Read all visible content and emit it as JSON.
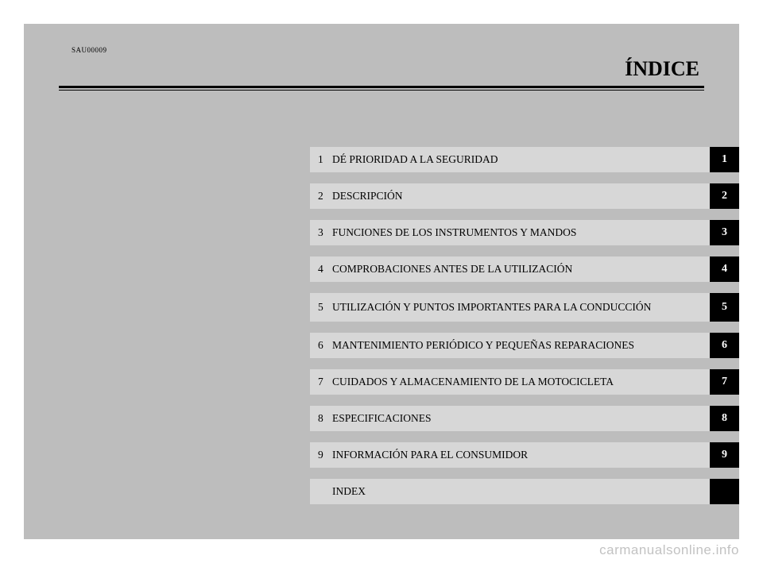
{
  "doc_id": "SAU00009",
  "page_title": "ÍNDICE",
  "toc": [
    {
      "num": "1",
      "label": "DÉ PRIORIDAD A LA SEGURIDAD",
      "tab": "1"
    },
    {
      "num": "2",
      "label": "DESCRIPCIÓN",
      "tab": "2"
    },
    {
      "num": "3",
      "label": "FUNCIONES DE LOS INSTRUMENTOS Y MANDOS",
      "tab": "3"
    },
    {
      "num": "4",
      "label": "COMPROBACIONES ANTES DE LA UTILIZACIÓN",
      "tab": "4"
    },
    {
      "num": "5",
      "label": "UTILIZACIÓN Y PUNTOS IMPORTANTES PARA LA CONDUCCIÓN",
      "tab": "5"
    },
    {
      "num": "6",
      "label": "MANTENIMIENTO PERIÓDICO Y PEQUEÑAS REPARACIONES",
      "tab": "6"
    },
    {
      "num": "7",
      "label": "CUIDADOS Y ALMACENAMIENTO DE LA MOTOCICLETA",
      "tab": "7"
    },
    {
      "num": "8",
      "label": "ESPECIFICACIONES",
      "tab": "8"
    },
    {
      "num": "9",
      "label": "INFORMACIÓN PARA EL CONSUMIDOR",
      "tab": "9"
    },
    {
      "num": "",
      "label": "INDEX",
      "tab": ""
    }
  ],
  "watermark": "carmanualsonline.info"
}
